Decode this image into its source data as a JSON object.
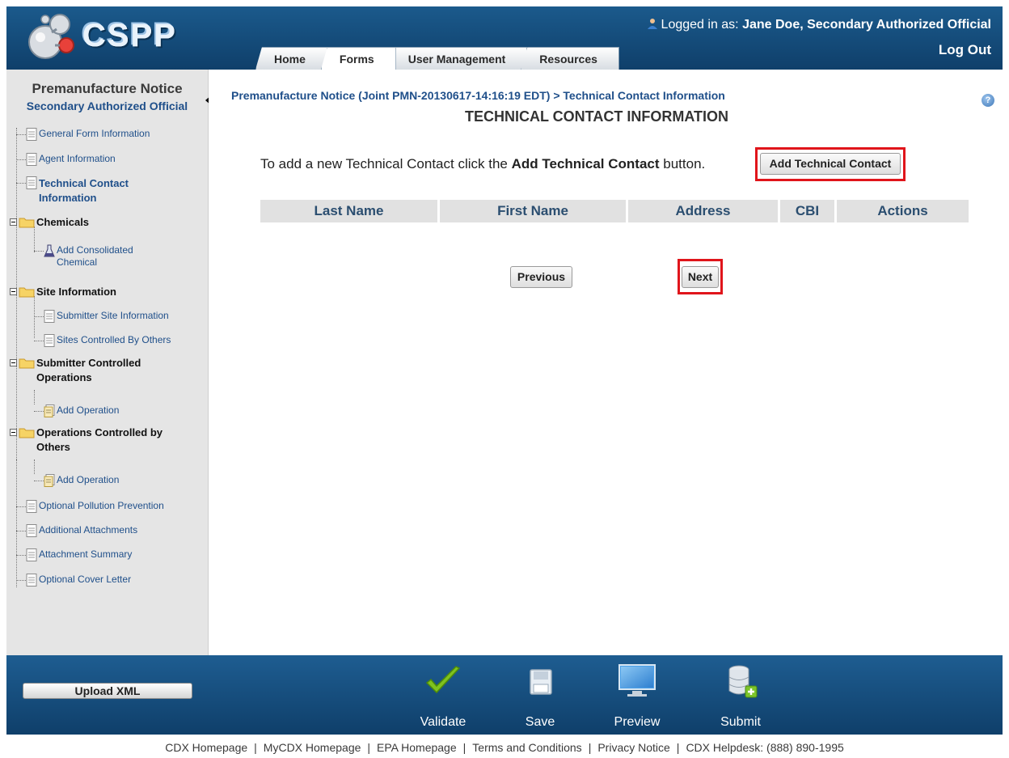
{
  "header": {
    "logo_text": "CSPP",
    "logged_in_prefix": "Logged in as:",
    "logged_in_user": "Jane Doe, Secondary Authorized Official",
    "logout_label": "Log Out",
    "tabs": [
      {
        "label": "Home"
      },
      {
        "label": "Forms",
        "active": true
      },
      {
        "label": "User Management"
      },
      {
        "label": "Resources"
      }
    ]
  },
  "sidebar": {
    "title": "Premanufacture Notice",
    "subtitle": "Secondary Authorized Official",
    "items": [
      {
        "label": "General Form Information",
        "type": "doc"
      },
      {
        "label": "Agent Information",
        "type": "doc"
      },
      {
        "label": "Technical Contact Information",
        "type": "doc",
        "current": true
      },
      {
        "label": "Chemicals",
        "type": "folder"
      },
      {
        "label": "Add Consolidated Chemical",
        "type": "flask"
      },
      {
        "label": "Site Information",
        "type": "folder"
      },
      {
        "label": "Submitter Site Information",
        "type": "doc"
      },
      {
        "label": "Sites Controlled By Others",
        "type": "doc"
      },
      {
        "label": "Submitter Controlled Operations",
        "type": "folder"
      },
      {
        "label": "Add Operation",
        "type": "add"
      },
      {
        "label": "Operations Controlled by Others",
        "type": "folder"
      },
      {
        "label": "Add Operation",
        "type": "add"
      },
      {
        "label": "Optional Pollution Prevention",
        "type": "doc"
      },
      {
        "label": "Additional Attachments",
        "type": "doc"
      },
      {
        "label": "Attachment Summary",
        "type": "doc"
      },
      {
        "label": "Optional Cover Letter",
        "type": "doc"
      }
    ]
  },
  "main": {
    "breadcrumb": "Premanufacture Notice (Joint PMN-20130617-14:16:19 EDT) > Technical Contact Information",
    "title": "TECHNICAL CONTACT INFORMATION",
    "help_icon": "?",
    "instruction_prefix": "To add a new Technical Contact click the",
    "instruction_bold": "Add Technical Contact",
    "instruction_suffix": "button.",
    "add_button": "Add Technical Contact",
    "table_headers": [
      "Last Name",
      "First Name",
      "Address",
      "CBI",
      "Actions"
    ],
    "previous_button": "Previous",
    "next_button": "Next"
  },
  "toolbar": {
    "upload_label": "Upload XML",
    "actions": [
      {
        "label": "Validate",
        "icon": "checkmark-icon"
      },
      {
        "label": "Save",
        "icon": "floppy-disk-icon"
      },
      {
        "label": "Preview",
        "icon": "monitor-icon"
      },
      {
        "label": "Submit",
        "icon": "database-add-icon"
      }
    ]
  },
  "footer_links": [
    "CDX Homepage",
    "MyCDX Homepage",
    "EPA Homepage",
    "Terms and Conditions",
    "Privacy Notice",
    "CDX Helpdesk: (888) 890-1995"
  ],
  "colors": {
    "header_blue": "#1b5a8c",
    "link_blue": "#1f4f8a",
    "highlight_red": "#e0151b"
  }
}
